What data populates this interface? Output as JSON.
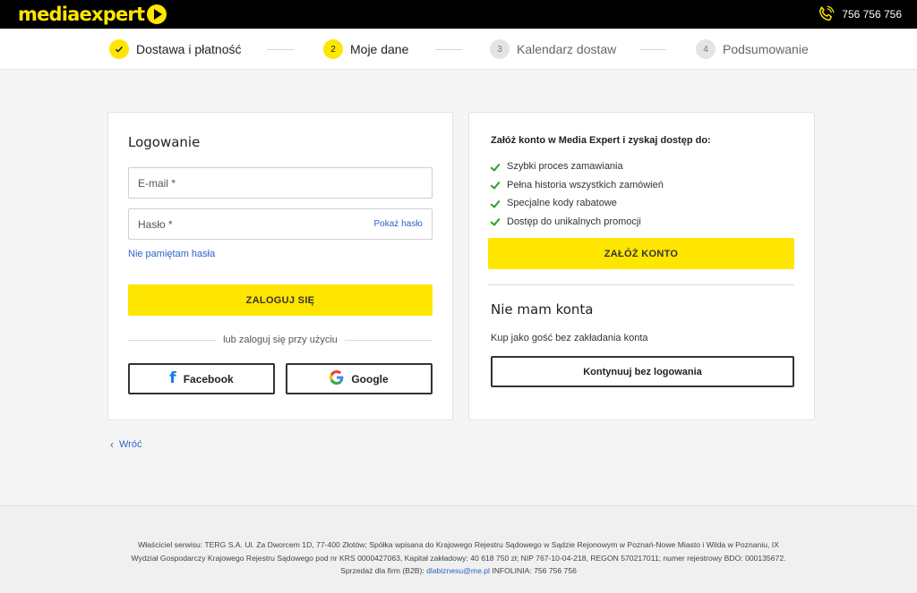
{
  "header": {
    "logo": {
      "part1": "media",
      "part2": "expert",
      "mark_icon": "play-circle-icon"
    },
    "phone": {
      "icon": "phone-icon",
      "number": "756 756 756"
    }
  },
  "steps": [
    {
      "label": "Dostawa i płatność",
      "state": "done",
      "marker": ""
    },
    {
      "label": "Moje dane",
      "state": "active",
      "marker": "2"
    },
    {
      "label": "Kalendarz dostaw",
      "state": "todo",
      "marker": "3"
    },
    {
      "label": "Podsumowanie",
      "state": "todo",
      "marker": "4"
    }
  ],
  "login": {
    "title": "Logowanie",
    "email_placeholder": "E-mail *",
    "password_placeholder": "Hasło *",
    "show_password": "Pokaż hasło",
    "forgot": "Nie pamiętam hasła",
    "submit": "ZALOGUJ SIĘ",
    "or_text": "lub zaloguj się przy użyciu",
    "facebook": "Facebook",
    "google": "Google"
  },
  "register": {
    "lead": "Załóż konto w Media Expert i zyskaj dostęp do:",
    "benefits": [
      "Szybki proces zamawiania",
      "Pełna historia wszystkich zamówień",
      "Specjalne kody rabatowe",
      "Dostęp do unikalnych promocji"
    ],
    "create_button": "ZAŁÓŻ KONTO",
    "no_account_title": "Nie mam konta",
    "guest_text": "Kup jako gość bez zakładania konta",
    "guest_button": "Kontynuuj bez logowania"
  },
  "back": "Wróć",
  "footer": {
    "line1": "Właściciel serwisu: TERG S.A. Ul. Za Dworcem 1D, 77-400 Złotów; Spółka wpisana do Krajowego Rejestru Sądowego w Sądzie Rejonowym w Poznań-Nowe Miasto i Wilda w Poznaniu, IX",
    "line2": "Wydział Gospodarczy Krajowego Rejestru Sądowego pod nr KRS 0000427063, Kapitał zakładowy: 40 618 750 zł; NIP 767-10-04-218, REGON 570217011; numer rejestrowy BDO: 000135672.",
    "b2b_label": "Sprzedaż dla firm (B2B):",
    "b2b_email": "dlabiznesu@me.pl",
    "hotline": "INFOLINIA: 756 756 756"
  },
  "colors": {
    "accent": "#ffe600",
    "link": "#2d63c8",
    "check": "#2e9d2e",
    "facebook": "#1877f2"
  }
}
